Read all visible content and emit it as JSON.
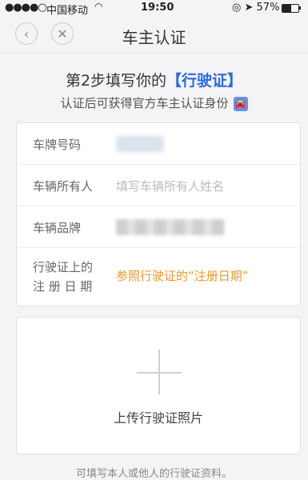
{
  "status_bar": {
    "signal": "●●●●○",
    "carrier": "中国移动",
    "wifi": "wifi-icon",
    "time": "19:50",
    "battery_percent": "57%",
    "battery_level": 0.57
  },
  "nav": {
    "title": "车主认证",
    "back_icon": "chevron-left-icon",
    "close_icon": "close-icon"
  },
  "intro": {
    "step_prefix": "第2步填写你的",
    "step_highlight": "【行驶证】",
    "subtitle": "认证后可获得官方车主认证身份"
  },
  "form": {
    "plate_label": "车牌号码",
    "owner_label": "车辆所有人",
    "owner_placeholder": "填写车辆所有人姓名",
    "brand_label": "车辆品牌",
    "reg_date_label_line1": "行驶证上的",
    "reg_date_label_line2": "注 册 日 期",
    "reg_date_hint": "参照行驶证的“注册日期”"
  },
  "upload": {
    "label": "上传行驶证照片"
  },
  "footnote": "可填写本人或他人的行驶证资料。",
  "colors": {
    "accent_blue": "#2f6ad8",
    "hint_orange": "#e89a2e",
    "background": "#f4f4f6"
  }
}
